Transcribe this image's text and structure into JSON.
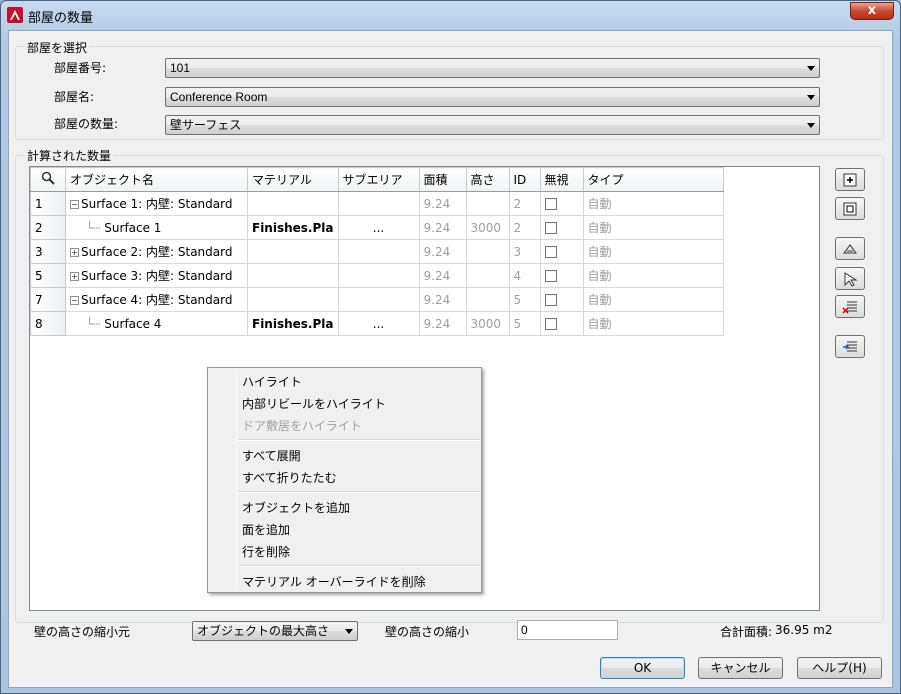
{
  "window": {
    "title": "部屋の数量",
    "close": "x"
  },
  "select_group": {
    "label": "部屋を選択",
    "room_number_label": "部屋番号:",
    "room_number_value": "101",
    "room_name_label": "部屋名:",
    "room_name_value": "Conference Room",
    "room_quantity_label": "部屋の数量:",
    "room_quantity_value": "壁サーフェス"
  },
  "calc_group": {
    "label": "計算された数量"
  },
  "grid": {
    "headers": [
      "オブジェクト名",
      "マテリアル",
      "サブエリア",
      "面積",
      "高さ",
      "ID",
      "無視",
      "タイプ"
    ],
    "rows": [
      {
        "num": "1",
        "sign": "⊟",
        "name": "Surface 1: 内壁: Standard",
        "material": "",
        "subarea": "",
        "area": "9.24",
        "height": "",
        "id": "2",
        "type": "自動"
      },
      {
        "num": "2",
        "sign": "",
        "name": "Surface 1",
        "material": "Finishes.Pla",
        "subarea": "...",
        "area": "9.24",
        "height": "3000",
        "id": "2",
        "type": "自動"
      },
      {
        "num": "3",
        "sign": "⊞",
        "name": "Surface 2: 内壁: Standard",
        "material": "",
        "subarea": "",
        "area": "9.24",
        "height": "",
        "id": "3",
        "type": "自動"
      },
      {
        "num": "5",
        "sign": "⊞",
        "name": "Surface 3: 内壁: Standard",
        "material": "",
        "subarea": "",
        "area": "9.24",
        "height": "",
        "id": "4",
        "type": "自動"
      },
      {
        "num": "7",
        "sign": "⊟",
        "name": "Surface 4: 内壁: Standard",
        "material": "",
        "subarea": "",
        "area": "9.24",
        "height": "",
        "id": "5",
        "type": "自動"
      },
      {
        "num": "8",
        "sign": "",
        "name": "Surface 4",
        "material": "Finishes.Pla",
        "subarea": "...",
        "area": "9.24",
        "height": "3000",
        "id": "5",
        "type": "自動"
      }
    ]
  },
  "context_menu": {
    "highlight": "ハイライト",
    "highlight_reveal": "内部リビールをハイライト",
    "highlight_door_sill": "ドア敷居をハイライト",
    "expand_all": "すべて展開",
    "collapse_all": "すべて折りたたむ",
    "add_object": "オブジェクトを追加",
    "add_face": "面を追加",
    "delete_row": "行を削除",
    "remove_material_override": "マテリアル オーバーライドを削除"
  },
  "bottom": {
    "wall_height_source_label": "壁の高さの縮小元",
    "wall_height_source_value": "オブジェクトの最大高さ",
    "wall_height_reduce_label": "壁の高さの縮小",
    "wall_height_reduce_value": "0",
    "total_area_label": "合計面積:",
    "total_area_value": "36.95 m2"
  },
  "buttons": {
    "ok": "OK",
    "cancel": "キャンセル",
    "help": "ヘルプ(H)"
  }
}
